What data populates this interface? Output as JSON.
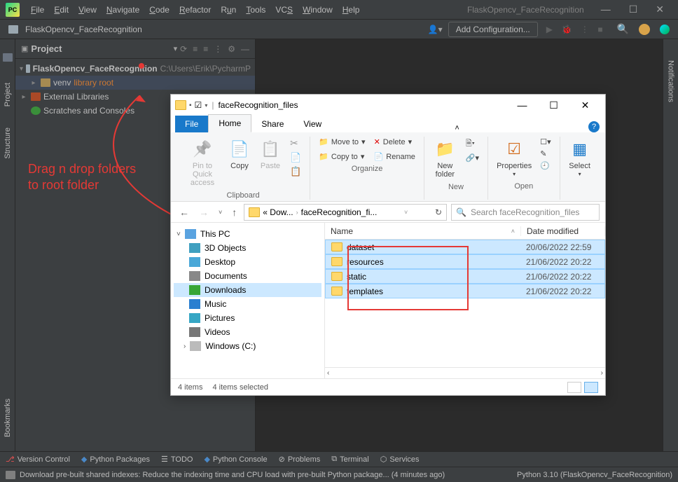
{
  "pycharm": {
    "menus": [
      "File",
      "Edit",
      "View",
      "Navigate",
      "Code",
      "Refactor",
      "Run",
      "Tools",
      "VCS",
      "Window",
      "Help"
    ],
    "title_project": "FlaskOpencv_FaceRecognition",
    "breadcrumb": "FlaskOpencv_FaceRecognition",
    "add_configuration": "Add Configuration...",
    "project_panel": {
      "label": "Project",
      "tree": {
        "root": "FlaskOpencv_FaceRecognition",
        "root_path": "C:\\Users\\Erik\\PycharmP",
        "venv": "venv",
        "venv_note": "library root",
        "ext_libs": "External Libraries",
        "scratches": "Scratches and Consoles"
      }
    },
    "left_gutter": [
      "Project",
      "Structure",
      "Bookmarks"
    ],
    "right_gutter": [
      "Notifications"
    ],
    "bottom_tools": [
      "Version Control",
      "Python Packages",
      "TODO",
      "Python Console",
      "Problems",
      "Terminal",
      "Services"
    ],
    "status_left": "Download pre-built shared indexes: Reduce the indexing time and CPU load with pre-built Python package... (4 minutes ago)",
    "status_right": "Python 3.10 (FlaskOpencv_FaceRecognition)"
  },
  "annotation": {
    "text_line1": "Drag n drop folders",
    "text_line2": "to root folder"
  },
  "explorer": {
    "title": "faceRecognition_files",
    "tabs": [
      "File",
      "Home",
      "Share",
      "View"
    ],
    "active_tab": "Home",
    "ribbon": {
      "pin": "Pin to Quick access",
      "copy": "Copy",
      "paste": "Paste",
      "moveto": "Move to",
      "copyto": "Copy to",
      "delete": "Delete",
      "rename": "Rename",
      "newfolder": "New folder",
      "properties": "Properties",
      "select": "Select",
      "group_clipboard": "Clipboard",
      "group_organize": "Organize",
      "group_new": "New",
      "group_open": "Open"
    },
    "address": {
      "crumb1": "« Dow...",
      "crumb2": "faceRecognition_fi...",
      "search_placeholder": "Search faceRecognition_files"
    },
    "navpane": [
      {
        "icon": "pc",
        "label": "This PC"
      },
      {
        "icon": "3d",
        "label": "3D Objects"
      },
      {
        "icon": "desktop",
        "label": "Desktop"
      },
      {
        "icon": "docs",
        "label": "Documents"
      },
      {
        "icon": "downloads",
        "label": "Downloads",
        "selected": true
      },
      {
        "icon": "music",
        "label": "Music"
      },
      {
        "icon": "pictures",
        "label": "Pictures"
      },
      {
        "icon": "videos",
        "label": "Videos"
      },
      {
        "icon": "drive",
        "label": "Windows (C:)"
      }
    ],
    "columns": {
      "name": "Name",
      "date": "Date modified"
    },
    "rows": [
      {
        "name": "dataset",
        "date": "20/06/2022 22:59",
        "selected": true
      },
      {
        "name": "resources",
        "date": "21/06/2022 20:22",
        "selected": true
      },
      {
        "name": "static",
        "date": "21/06/2022 20:22",
        "selected": true
      },
      {
        "name": "templates",
        "date": "21/06/2022 20:22",
        "selected": true
      }
    ],
    "status": {
      "items": "4 items",
      "selected": "4 items selected"
    }
  }
}
